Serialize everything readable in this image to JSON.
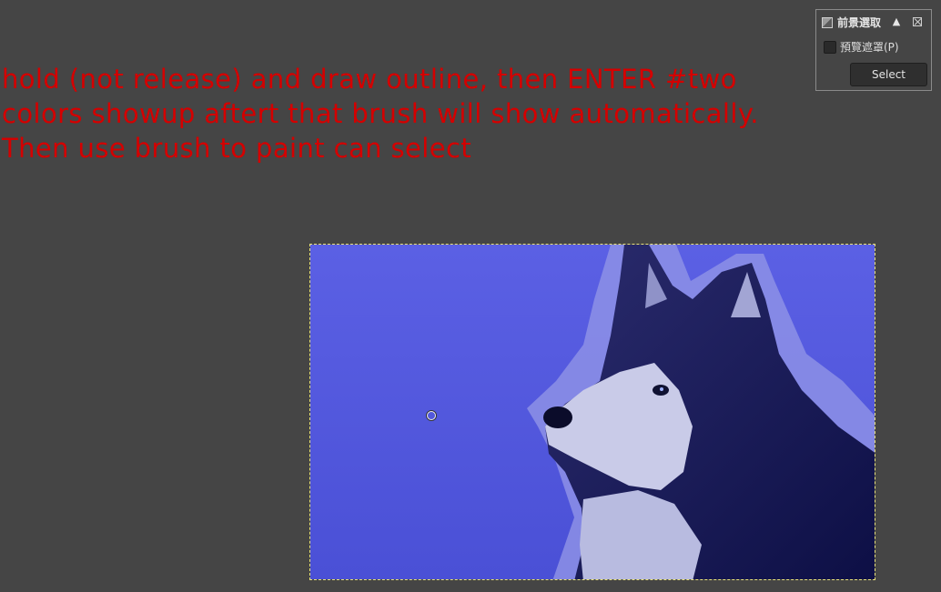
{
  "annotation": {
    "text": "hold (not release) and draw outline, then ENTER #two\ncolors showup aftert that brush will show automatically.\nThen use brush to paint can select",
    "color": "#d40000"
  },
  "canvas": {
    "background": "#454545",
    "selection_outline_color": "#e9e27a"
  },
  "foreground_select_panel": {
    "title": "前景選取",
    "tool_icon": "foreground-select-tool-icon",
    "eject_icon_glyph": "▲",
    "close_icon": "close-icon",
    "preview_mask_label": "預覽遮罩(P)",
    "preview_mask_checked": false,
    "select_label": "Select"
  },
  "image": {
    "subject": "husky",
    "overlay_color": "#5a5fe0"
  }
}
